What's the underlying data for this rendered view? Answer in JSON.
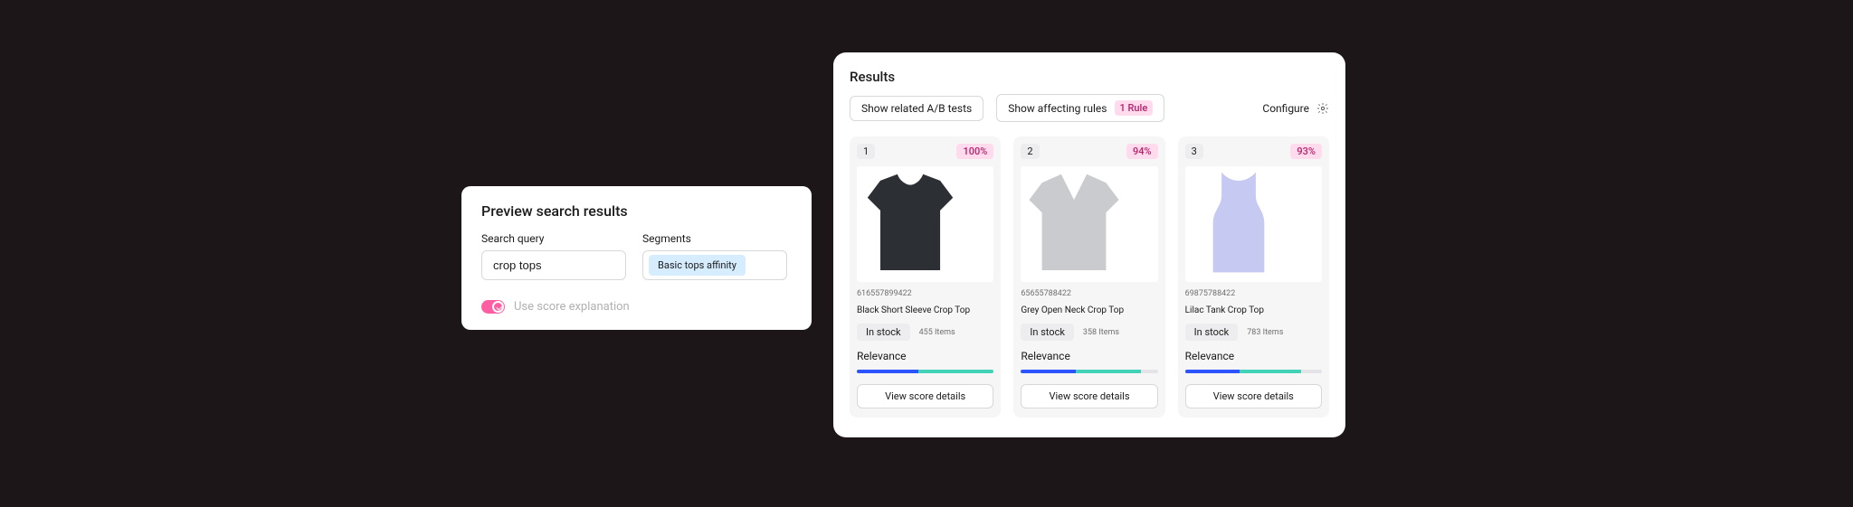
{
  "preview": {
    "title": "Preview search results",
    "search_label": "Search query",
    "search_value": "crop tops",
    "segments_label": "Segments",
    "segment_chip": "Basic tops affinity",
    "toggle_label": "Use score explanation",
    "toggle_on": true
  },
  "results": {
    "title": "Results",
    "ab_button": "Show related A/B tests",
    "rules_button": "Show affecting rules",
    "rules_badge": "1 Rule",
    "configure_label": "Configure",
    "relevance_label": "Relevance",
    "stock_label": "In stock",
    "items_suffix": "Items",
    "view_label": "View score details",
    "cards": [
      {
        "rank": "1",
        "score": "100%",
        "sku": "616557899422",
        "name": "Black Short Sleeve Crop Top",
        "items": "455",
        "rel_blue_pct": 45,
        "rel_teal_pct": 55,
        "shirt_fill": "#2c2f33",
        "shirt_kind": "tee"
      },
      {
        "rank": "2",
        "score": "94%",
        "sku": "65655788422",
        "name": "Grey Open Neck Crop Top",
        "items": "358",
        "rel_blue_pct": 40,
        "rel_teal_pct": 48,
        "shirt_fill": "#c9cbcf",
        "shirt_kind": "vneck"
      },
      {
        "rank": "3",
        "score": "93%",
        "sku": "69875788422",
        "name": "Lilac Tank Crop Top",
        "items": "783",
        "rel_blue_pct": 40,
        "rel_teal_pct": 45,
        "shirt_fill": "#c6c9f2",
        "shirt_kind": "tank"
      }
    ]
  }
}
